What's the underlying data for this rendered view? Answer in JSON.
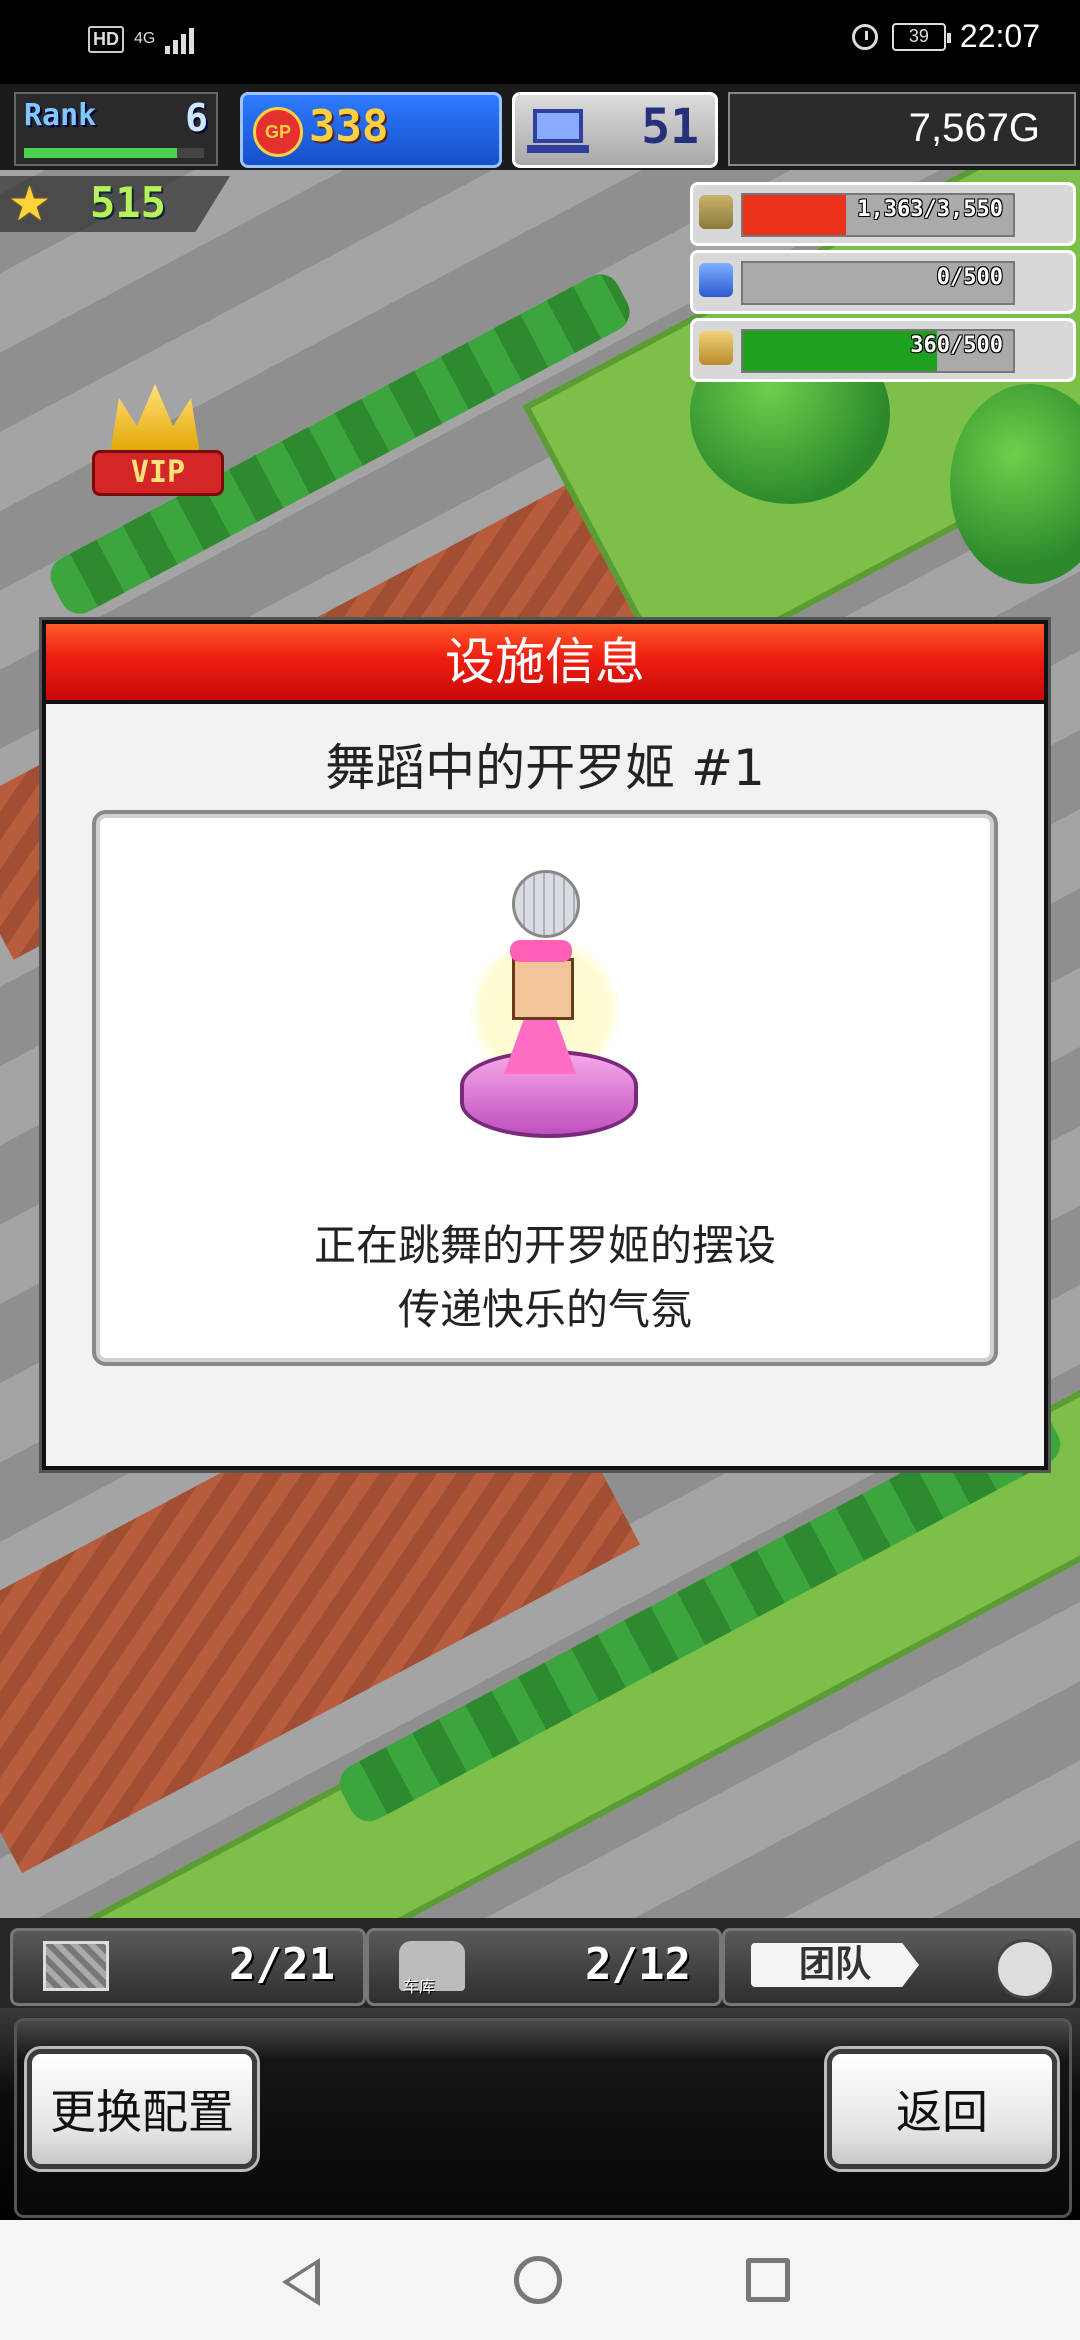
{
  "status_bar": {
    "hd": "HD",
    "network": "4G",
    "battery": "39",
    "time": "22:07"
  },
  "hud": {
    "rank_label": "Rank",
    "rank_value": "6",
    "rank_progress": 0.85,
    "gp_icon_label": "GP",
    "gp_value": "338",
    "pc_value": "51",
    "money": "7,567G",
    "stars": "515",
    "resources": [
      {
        "icon": "coins-icon",
        "text": "1,363/3,550",
        "fill": 0.38,
        "color": "#e8321c"
      },
      {
        "icon": "fuel-icon",
        "text": "0/500",
        "fill": 0.0,
        "color": "#3a7bff"
      },
      {
        "icon": "wheat-icon",
        "text": "360/500",
        "fill": 0.72,
        "color": "#1ea11e"
      }
    ]
  },
  "scene": {
    "vip_label": "VIP"
  },
  "dialog": {
    "header": "设施信息",
    "title": "舞蹈中的开罗姬 #1",
    "desc_line1": "正在跳舞的开罗姬的摆设",
    "desc_line2": "传递快乐的气氛"
  },
  "bottom": {
    "slot1_text": "2/21",
    "slot2_label": "车库",
    "slot2_text": "2/12",
    "team_label": "团队",
    "change_button": "更换配置",
    "back_button": "返回"
  }
}
